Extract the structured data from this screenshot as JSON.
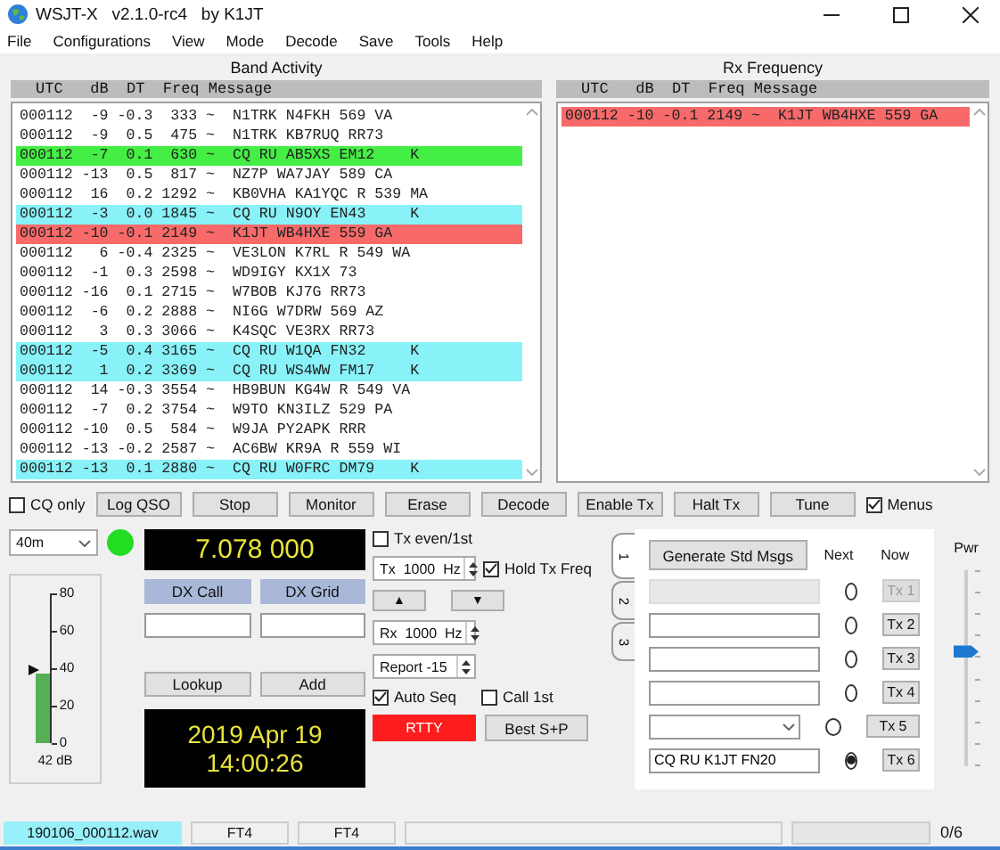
{
  "window": {
    "title": "WSJT-X   v2.1.0-rc4   by K1JT"
  },
  "menu": [
    "File",
    "Configurations",
    "View",
    "Mode",
    "Decode",
    "Save",
    "Tools",
    "Help"
  ],
  "band_activity": {
    "title": "Band Activity",
    "columns": [
      "UTC",
      "dB",
      "DT",
      "Freq",
      "Message"
    ],
    "rows": [
      {
        "text": "000112  -9 -0.3  333 ~  N1TRK N4FKH 569 VA",
        "color": "#ffffff"
      },
      {
        "text": "000112  -9  0.5  475 ~  N1TRK KB7RUQ RR73",
        "color": "#ffffff"
      },
      {
        "text": "000112  -7  0.1  630 ~  CQ RU AB5XS EM12    K",
        "color": "#44ee44"
      },
      {
        "text": "000112 -13  0.5  817 ~  NZ7P WA7JAY 589 CA",
        "color": "#ffffff"
      },
      {
        "text": "000112  16  0.2 1292 ~  KB0VHA KA1YQC R 539 MA",
        "color": "#ffffff"
      },
      {
        "text": "000112  -3  0.0 1845 ~  CQ RU N9OY EN43     K",
        "color": "#88f2f8"
      },
      {
        "text": "000112 -10 -0.1 2149 ~  K1JT WB4HXE 559 GA",
        "color": "#f86a6a"
      },
      {
        "text": "000112   6 -0.4 2325 ~  VE3LON K7RL R 549 WA",
        "color": "#ffffff"
      },
      {
        "text": "000112  -1  0.3 2598 ~  WD9IGY KX1X 73",
        "color": "#ffffff"
      },
      {
        "text": "000112 -16  0.1 2715 ~  W7BOB KJ7G RR73",
        "color": "#ffffff"
      },
      {
        "text": "000112  -6  0.2 2888 ~  NI6G W7DRW 569 AZ",
        "color": "#ffffff"
      },
      {
        "text": "000112   3  0.3 3066 ~  K4SQC VE3RX RR73",
        "color": "#ffffff"
      },
      {
        "text": "000112  -5  0.4 3165 ~  CQ RU W1QA FN32     K",
        "color": "#88f2f8"
      },
      {
        "text": "000112   1  0.2 3369 ~  CQ RU WS4WW FM17    K",
        "color": "#88f2f8"
      },
      {
        "text": "000112  14 -0.3 3554 ~  HB9BUN KG4W R 549 VA",
        "color": "#ffffff"
      },
      {
        "text": "000112  -7  0.2 3754 ~  W9TO KN3ILZ 529 PA",
        "color": "#ffffff"
      },
      {
        "text": "000112 -10  0.5  584 ~  W9JA PY2APK RRR",
        "color": "#ffffff"
      },
      {
        "text": "000112 -13 -0.2 2587 ~  AC6BW KR9A R 559 WI",
        "color": "#ffffff"
      },
      {
        "text": "000112 -13  0.1 2880 ~  CQ RU W0FRC DM79    K",
        "color": "#88f2f8"
      }
    ]
  },
  "rx_frequency": {
    "title": "Rx Frequency",
    "columns": [
      "UTC",
      "dB",
      "DT",
      "Freq",
      "Message"
    ],
    "rows": [
      {
        "text": "000112 -10 -0.1 2149 ~  K1JT WB4HXE 559 GA",
        "color": "#f86a6a"
      }
    ]
  },
  "cq_only": {
    "label": "CQ only",
    "checked": false
  },
  "buttons": [
    "Log QSO",
    "Stop",
    "Monitor",
    "Erase",
    "Decode",
    "Enable Tx",
    "Halt Tx",
    "Tune"
  ],
  "menus": {
    "label": "Menus",
    "checked": true
  },
  "band": {
    "value": "40m"
  },
  "rx_indicator": {
    "on": true
  },
  "meter": {
    "ticks": [
      "80",
      "60",
      "40",
      "20",
      "0"
    ],
    "level": 0.47,
    "reading": "42 dB"
  },
  "frequency": "7.078 000",
  "dx_call": {
    "label": "DX Call"
  },
  "dx_grid": {
    "label": "DX Grid"
  },
  "lookup": "Lookup",
  "add": "Add",
  "date": "2019 Apr 19",
  "time": "14:00:26",
  "tx_even": {
    "label": "Tx even/1st",
    "checked": false
  },
  "tx_freq": "Tx  1000  Hz",
  "hold_tx_freq": {
    "label": "Hold Tx Freq",
    "checked": true
  },
  "arrow_buttons": [
    "▲",
    "▼"
  ],
  "rx_freq": "Rx  1000  Hz",
  "report": "Report -15",
  "auto_seq": {
    "label": "Auto Seq",
    "checked": true
  },
  "call_1st": {
    "label": "Call 1st",
    "checked": false
  },
  "rtty": {
    "label": "RTTY",
    "on": true
  },
  "best_sp": "Best S+P",
  "tabs": [
    {
      "label": "1",
      "selected": true
    },
    {
      "label": "2",
      "selected": false
    },
    {
      "label": "3",
      "selected": false
    }
  ],
  "messages": {
    "generate": "Generate Std Msgs",
    "next_label": "Next",
    "now_label": "Now",
    "rows": [
      {
        "kind": "field",
        "disabled": true,
        "selected": false,
        "button": "Tx 1"
      },
      {
        "kind": "field",
        "disabled": false,
        "selected": false,
        "button": "Tx 2"
      },
      {
        "kind": "field",
        "disabled": false,
        "selected": false,
        "button": "Tx 3"
      },
      {
        "kind": "field",
        "disabled": false,
        "selected": false,
        "button": "Tx 4"
      },
      {
        "kind": "combo",
        "disabled": false,
        "selected": false,
        "button": "Tx 5"
      },
      {
        "kind": "field",
        "value": "CQ RU K1JT FN20",
        "disabled": false,
        "selected": true,
        "button": "Tx 6"
      }
    ]
  },
  "power": {
    "label": "Pwr",
    "level": 0.58
  },
  "status_bar": {
    "file": "190106_000112.wav",
    "mode": "FT4",
    "submode": "FT4",
    "count": "0/6"
  }
}
